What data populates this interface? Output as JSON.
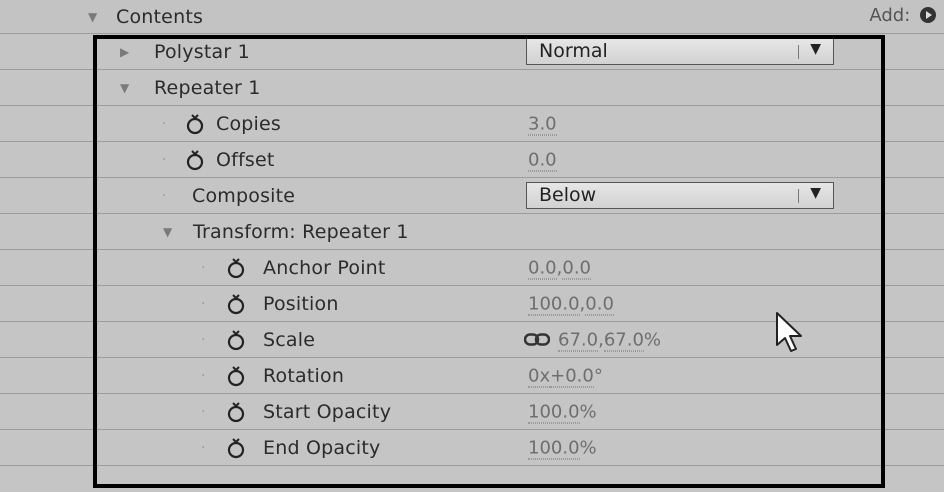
{
  "header": {
    "contents_label": "Contents",
    "add_label": "Add:"
  },
  "rows": {
    "polystar": {
      "label": "Polystar 1",
      "mode": "Normal"
    },
    "repeater": {
      "label": "Repeater 1"
    },
    "copies": {
      "label": "Copies",
      "value": "3.0"
    },
    "offset": {
      "label": "Offset",
      "value": "0.0"
    },
    "composite": {
      "label": "Composite",
      "mode": "Below"
    },
    "transform": {
      "label": "Transform: Repeater 1"
    },
    "anchor_point": {
      "label": "Anchor Point",
      "x": "0.0",
      "y": "0.0"
    },
    "position": {
      "label": "Position",
      "x": "100.0",
      "y": "0.0"
    },
    "scale": {
      "label": "Scale",
      "x": "67.0",
      "y": "67.0",
      "unit": "%"
    },
    "rotation": {
      "label": "Rotation",
      "turns": "0x",
      "degrees": "+0.0",
      "unit": "°"
    },
    "start_opacity": {
      "label": "Start Opacity",
      "value": "100.0",
      "unit": "%"
    },
    "end_opacity": {
      "label": "End Opacity",
      "value": "100.0",
      "unit": "%"
    }
  }
}
